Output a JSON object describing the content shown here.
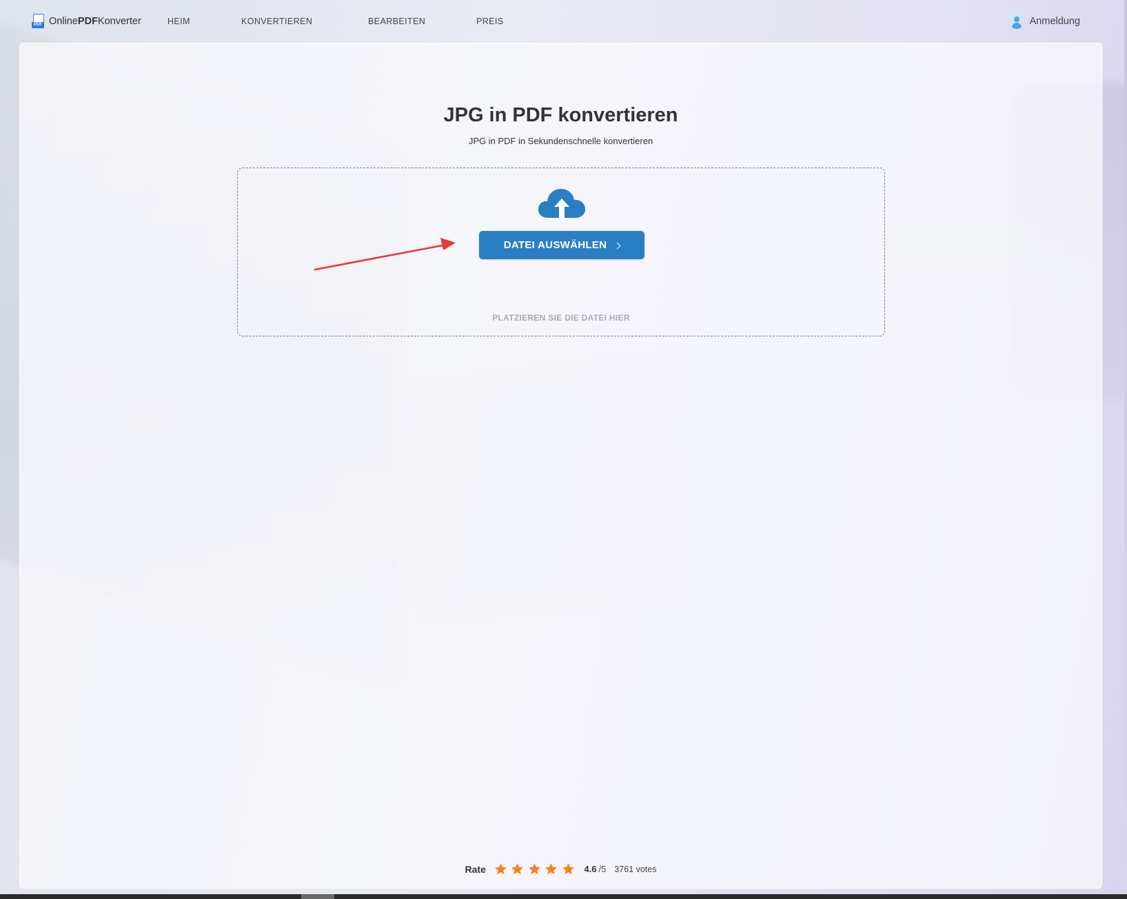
{
  "brand": {
    "prefix": "Online",
    "bold": "PDF",
    "suffix": "Konverter",
    "icon_tag": "PDF",
    "accent": "#2a7fc4"
  },
  "nav": {
    "items": [
      {
        "label": "HEIM"
      },
      {
        "label": "KONVERTIEREN"
      },
      {
        "label": "BEARBEITEN"
      },
      {
        "label": "PREIS"
      }
    ]
  },
  "login": {
    "label": "Anmeldung",
    "icon": "user-icon"
  },
  "main": {
    "title": "JPG in PDF konvertieren",
    "subtitle": "JPG in PDF in Sekundenschnelle konvertieren",
    "upload_icon": "cloud-upload-icon",
    "choose_button": "DATEI AUSWÄHLEN",
    "drop_hint": "PLATZIEREN SIE DIE DATEI HIER",
    "annotation_color": "#e8383d"
  },
  "rating": {
    "label": "Rate",
    "stars": 5,
    "score": "4.6",
    "max": "/5",
    "votes": "3761 votes",
    "star_color": "#f5811f"
  }
}
